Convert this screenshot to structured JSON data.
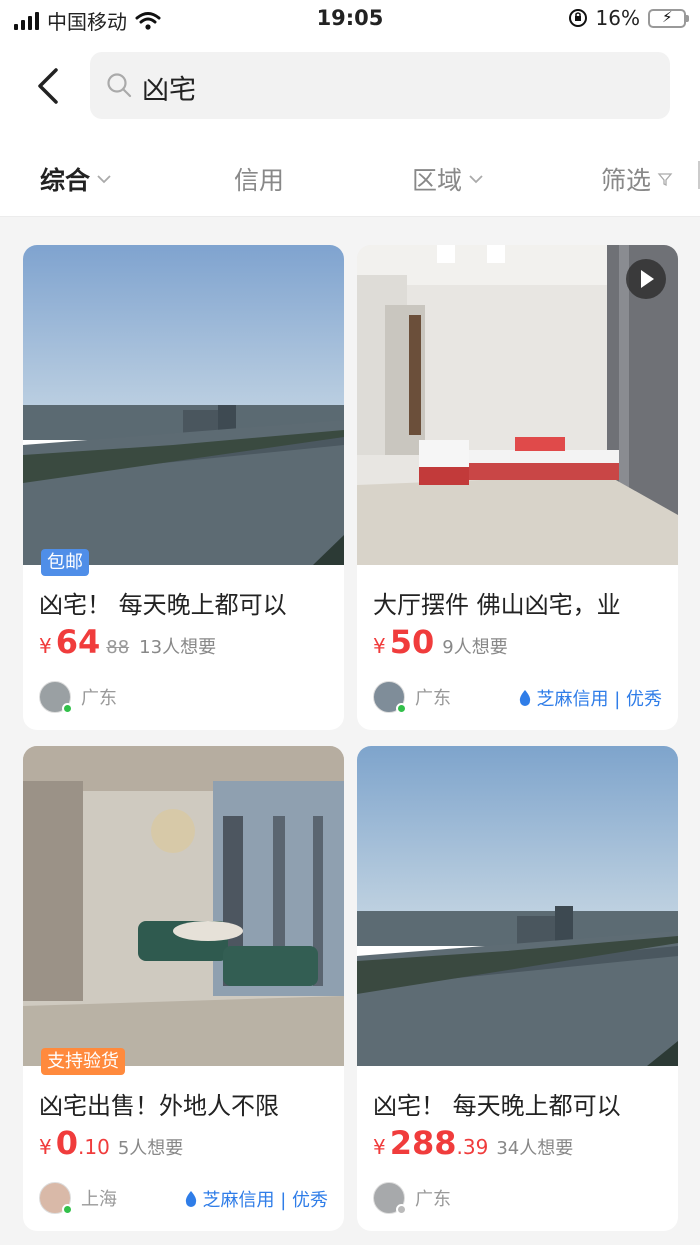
{
  "status_bar": {
    "carrier": "中国移动",
    "time": "19:05",
    "battery": "16%"
  },
  "search": {
    "query": "凶宅"
  },
  "filters": [
    {
      "label": "综合",
      "active": true,
      "has_dropdown": true
    },
    {
      "label": "信用",
      "active": false,
      "has_dropdown": false
    },
    {
      "label": "区域",
      "active": false,
      "has_dropdown": true
    },
    {
      "label": "筛选",
      "active": false,
      "has_dropdown": false
    }
  ],
  "colors": {
    "price": "#f03c3c",
    "credit": "#2f7de8",
    "online": "#32c04a"
  },
  "listings": [
    {
      "tag": "包邮",
      "title": "凶宅！ 每天晚上都可以",
      "currency": "¥",
      "price_int": "64",
      "price_dec": "",
      "original_price": "88",
      "want": "13人想要",
      "location": "广东",
      "credit": "",
      "has_video": false,
      "image": "river-icon"
    },
    {
      "tag": "",
      "title": "大厅摆件 佛山凶宅，业",
      "currency": "¥",
      "price_int": "50",
      "price_dec": "",
      "original_price": "",
      "want": "9人想要",
      "location": "广东",
      "credit": "芝麻信用 | 优秀",
      "has_video": true,
      "image": "living-room-icon"
    },
    {
      "tag": "支持验货",
      "title": "凶宅出售！外地人不限",
      "currency": "¥",
      "price_int": "0",
      "price_dec": ".10",
      "original_price": "",
      "want": "5人想要",
      "location": "上海",
      "credit": "芝麻信用 | 优秀",
      "has_video": false,
      "image": "hall-icon"
    },
    {
      "tag": "",
      "title": "凶宅！ 每天晚上都可以",
      "currency": "¥",
      "price_int": "288",
      "price_dec": ".39",
      "original_price": "",
      "want": "34人想要",
      "location": "广东",
      "credit": "",
      "has_video": false,
      "image": "river-icon"
    }
  ]
}
